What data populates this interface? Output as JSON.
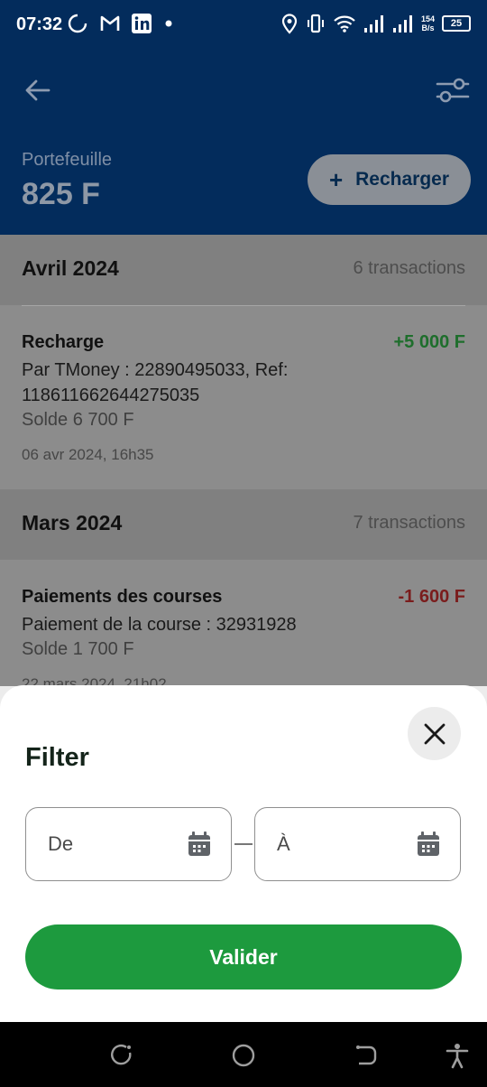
{
  "status_bar": {
    "time": "07:32",
    "net_speed_value": "154",
    "net_speed_unit": "B/s",
    "battery": "25",
    "icons_left": [
      "sync-icon",
      "gmail-icon",
      "linkedin-icon",
      "dot-icon"
    ],
    "icons_right": [
      "location-icon",
      "vibrate-icon",
      "wifi-icon",
      "signal-icon",
      "signal-icon"
    ]
  },
  "header": {
    "wallet_label": "Portefeuille",
    "wallet_amount": "825 F",
    "recharge_label": "Recharger"
  },
  "months": [
    {
      "title": "Avril 2024",
      "count": "6 transactions",
      "transactions": [
        {
          "title": "Recharge",
          "amount": "+5 000 F",
          "amount_color": "#1e6e2c",
          "description": "Par TMoney : 22890495033, Ref: 118611662644275035",
          "balance": "Solde 6 700 F",
          "date": "06 avr 2024, 16h35"
        }
      ]
    },
    {
      "title": "Mars 2024",
      "count": "7 transactions",
      "transactions": [
        {
          "title": "Paiements des courses",
          "amount": "-1 600 F",
          "amount_color": "#7a1c1c",
          "description": "Paiement de la course : 32931928",
          "balance": "Solde 1 700 F",
          "date": "22 mars 2024, 21h02"
        }
      ]
    }
  ],
  "filter_sheet": {
    "title": "Filter",
    "from_placeholder": "De",
    "to_placeholder": "À",
    "validate_label": "Valider"
  },
  "colors": {
    "header_bg": "#032c5c",
    "accent_green": "#1d9a3e"
  }
}
